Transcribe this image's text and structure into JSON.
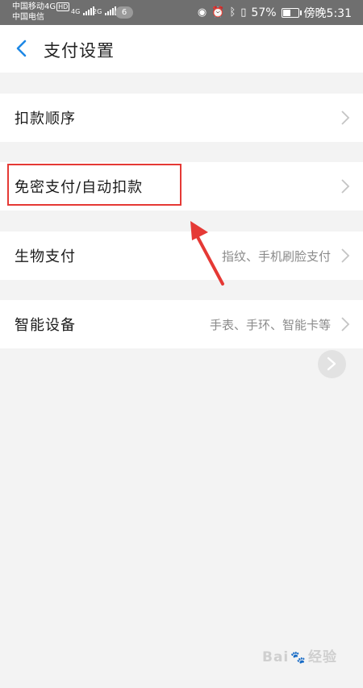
{
  "status_bar": {
    "carrier1": "中国移动4G",
    "carrier1_badge": "HD",
    "carrier2": "中国电信",
    "signal1": "4G",
    "signal2": "2G",
    "notification_count": "6",
    "battery_percent": "57%",
    "battery_level": 0.57,
    "time": "傍晚5:31",
    "icons": [
      "eye-icon",
      "alarm-icon",
      "bluetooth-icon",
      "vibrate-icon",
      "battery-icon"
    ]
  },
  "header": {
    "title": "支付设置",
    "back_icon": "chevron-left-icon"
  },
  "settings": {
    "items": [
      {
        "label": "扣款顺序",
        "value": ""
      },
      {
        "label": "免密支付/自动扣款",
        "value": ""
      },
      {
        "label": "生物支付",
        "value": "指纹、手机刷脸支付"
      },
      {
        "label": "智能设备",
        "value": "手表、手环、智能卡等"
      }
    ]
  },
  "watermark": {
    "text_left": "Bai",
    "text_right": "经验"
  },
  "colors": {
    "accent": "#1e88e5",
    "highlight": "#e53935",
    "status_bar": "#6f6f6f"
  }
}
